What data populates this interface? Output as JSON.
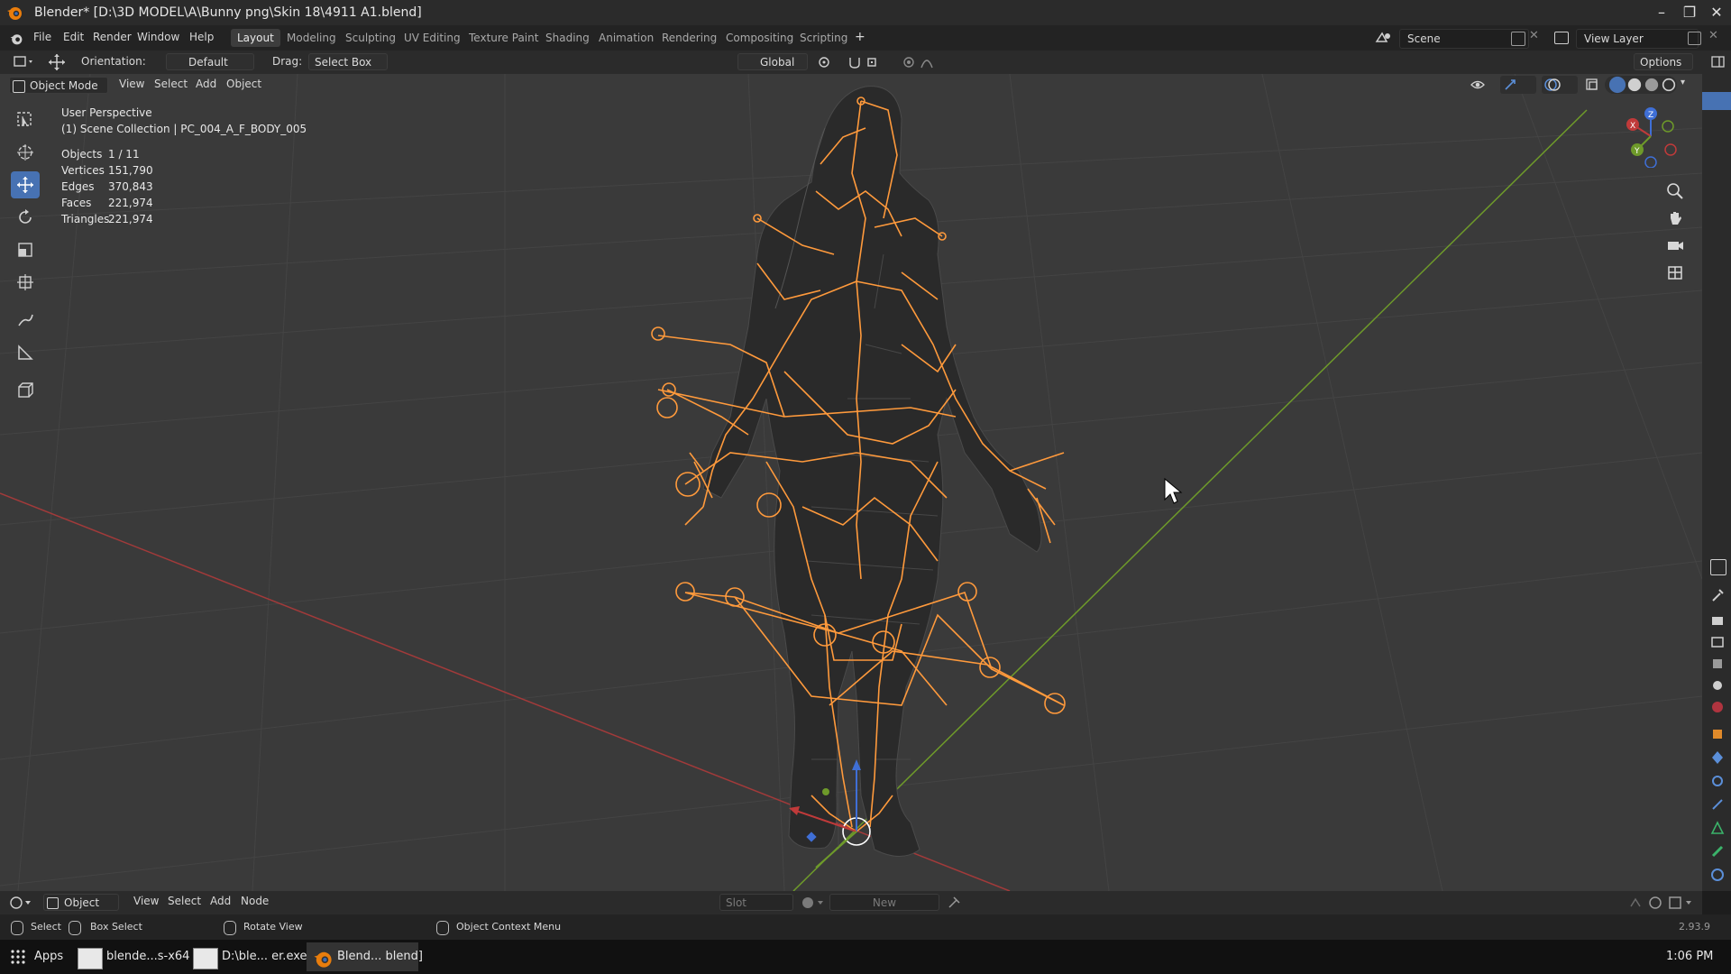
{
  "window": {
    "title": "Blender* [D:\\3D MODEL\\A\\Bunny png\\Skin 18\\4911 A1.blend]",
    "minimize": "–",
    "maximize": "❐",
    "close": "✕"
  },
  "menubar": {
    "items": [
      "File",
      "Edit",
      "Render",
      "Window",
      "Help"
    ],
    "workspace_tabs": [
      "Layout",
      "Modeling",
      "Sculpting",
      "UV Editing",
      "Texture Paint",
      "Shading",
      "Animation",
      "Rendering",
      "Compositing",
      "Scripting"
    ],
    "active_tab": "Layout",
    "add_tab": "+",
    "scene": "Scene",
    "view_layer": "View Layer"
  },
  "toolheader": {
    "orientation_label": "Orientation:",
    "orientation_value": "Default",
    "drag_label": "Drag:",
    "drag_value": "Select Box",
    "transform_orientation": "Global",
    "options": "Options"
  },
  "viewport_header": {
    "mode": "Object Mode",
    "menus": [
      "View",
      "Select",
      "Add",
      "Object"
    ]
  },
  "viewport_overlay": {
    "perspective": "User Perspective",
    "collection": "(1) Scene Collection | PC_004_A_F_BODY_005",
    "stats": [
      {
        "label": "Objects",
        "value": "1 / 11"
      },
      {
        "label": "Vertices",
        "value": "151,790"
      },
      {
        "label": "Edges",
        "value": "370,843"
      },
      {
        "label": "Faces",
        "value": "221,974"
      },
      {
        "label": "Triangles",
        "value": "221,974"
      }
    ]
  },
  "gizmo": {
    "x": "X",
    "y": "Y",
    "z": "Z"
  },
  "bottom_header": {
    "editor": "Object",
    "menus": [
      "View",
      "Select",
      "Add",
      "Node"
    ],
    "slot": "Slot",
    "new": "New"
  },
  "statusbar": {
    "select": "Select",
    "box_select": "Box Select",
    "rotate_view": "Rotate View",
    "context_menu": "Object Context Menu",
    "version": "2.93.9"
  },
  "taskbar": {
    "apps": "Apps",
    "tasks": [
      "blende...s-x64",
      "D:\\ble... er.exe",
      "Blend... blend]"
    ],
    "time": "1:06 PM"
  },
  "colors": {
    "accent": "#4772b3",
    "armature": "#ff9a3c",
    "x_axis": "#a23a3a",
    "y_axis": "#6e9a2a",
    "z_axis": "#3f6fd6"
  }
}
